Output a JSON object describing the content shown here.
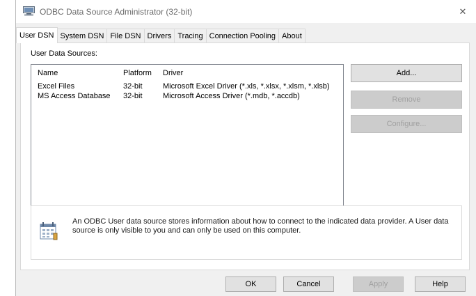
{
  "window": {
    "title": "ODBC Data Source Administrator (32-bit)",
    "close_glyph": "✕"
  },
  "tabs": [
    {
      "label": "User DSN",
      "active": true
    },
    {
      "label": "System DSN",
      "active": false
    },
    {
      "label": "File DSN",
      "active": false
    },
    {
      "label": "Drivers",
      "active": false
    },
    {
      "label": "Tracing",
      "active": false
    },
    {
      "label": "Connection Pooling",
      "active": false
    },
    {
      "label": "About",
      "active": false
    }
  ],
  "user_dsn": {
    "group_label": "User Data Sources:",
    "columns": {
      "name": "Name",
      "platform": "Platform",
      "driver": "Driver"
    },
    "rows": [
      {
        "name": "Excel Files",
        "platform": "32-bit",
        "driver": "Microsoft Excel Driver (*.xls, *.xlsx, *.xlsm, *.xlsb)"
      },
      {
        "name": "MS Access Database",
        "platform": "32-bit",
        "driver": "Microsoft Access Driver (*.mdb, *.accdb)"
      }
    ],
    "scroll_left": "<",
    "scroll_right": ">",
    "buttons": {
      "add": "Add...",
      "remove": "Remove",
      "configure": "Configure..."
    },
    "info_text": "An ODBC User data source stores information about how to connect to the indicated data provider.  A User data source is only visible to you and can only be used on this computer."
  },
  "footer": {
    "ok": "OK",
    "cancel": "Cancel",
    "apply": "Apply",
    "help": "Help"
  },
  "colors": {
    "disabled_text": "#a0a0a0",
    "button_face": "#e1e1e1",
    "border": "#adadad"
  },
  "icons": [
    "odbc-app-icon",
    "close-icon",
    "data-source-info-icon"
  ]
}
